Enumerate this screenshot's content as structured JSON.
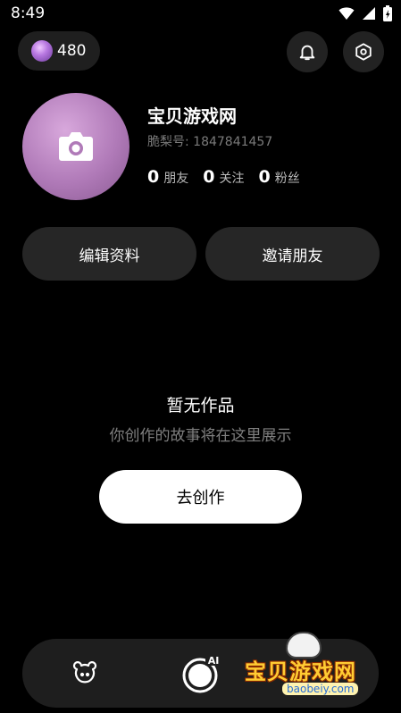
{
  "status_bar": {
    "time": "8:49"
  },
  "header": {
    "coin_count": "480"
  },
  "profile": {
    "name": "宝贝游戏网",
    "id_label": "脆梨号: 1847841457",
    "stats": [
      {
        "value": "0",
        "label": "朋友"
      },
      {
        "value": "0",
        "label": "关注"
      },
      {
        "value": "0",
        "label": "粉丝"
      }
    ]
  },
  "actions": {
    "edit_label": "编辑资料",
    "invite_label": "邀请朋友"
  },
  "empty_state": {
    "title": "暂无作品",
    "subtitle": "你创作的故事将在这里展示",
    "button_label": "去创作"
  },
  "bottom_nav": {
    "ai_badge": "AI"
  },
  "watermark": {
    "text": "宝贝游戏网",
    "url": "baobeiy.com"
  }
}
